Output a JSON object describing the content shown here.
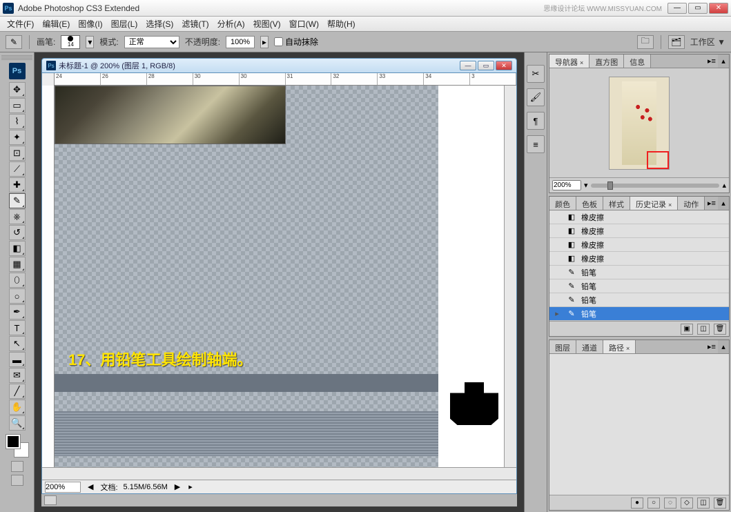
{
  "titlebar": {
    "app_name": "Adobe Photoshop CS3 Extended",
    "ps_abbrev": "Ps",
    "watermark": "思缘设计论坛  WWW.MISSYUAN.COM"
  },
  "menu": {
    "items": [
      "文件(F)",
      "编辑(E)",
      "图像(I)",
      "图层(L)",
      "选择(S)",
      "滤镜(T)",
      "分析(A)",
      "视图(V)",
      "窗口(W)",
      "帮助(H)"
    ]
  },
  "options": {
    "brush_label": "画笔:",
    "brush_size": "14",
    "mode_label": "模式:",
    "mode_value": "正常",
    "opacity_label": "不透明度:",
    "opacity_value": "100%",
    "auto_erase": "自动抹除",
    "workspace": "工作区 ▼"
  },
  "document": {
    "title": "未标题-1 @ 200% (图层 1, RGB/8)",
    "ruler_h": [
      "24",
      "26",
      "28",
      "30",
      "30",
      "31",
      "32",
      "33",
      "34",
      "3"
    ],
    "zoom": "200%",
    "filesize_label": "文档:",
    "filesize": "5.15M/6.56M",
    "annotation": "17、用铅笔工具绘制轴端。"
  },
  "navigator": {
    "tabs": [
      "导航器",
      "直方图",
      "信息"
    ],
    "zoom": "200%"
  },
  "history_panel": {
    "tabs": [
      "颜色",
      "色板",
      "样式",
      "历史记录",
      "动作"
    ],
    "items": [
      {
        "icon": "eraser",
        "label": "橡皮擦",
        "selected": false
      },
      {
        "icon": "eraser",
        "label": "橡皮擦",
        "selected": false
      },
      {
        "icon": "eraser",
        "label": "橡皮擦",
        "selected": false
      },
      {
        "icon": "eraser",
        "label": "橡皮擦",
        "selected": false
      },
      {
        "icon": "pencil",
        "label": "铅笔",
        "selected": false
      },
      {
        "icon": "pencil",
        "label": "铅笔",
        "selected": false
      },
      {
        "icon": "pencil",
        "label": "铅笔",
        "selected": false
      },
      {
        "icon": "pencil",
        "label": "铅笔",
        "selected": true
      }
    ]
  },
  "paths_panel": {
    "tabs": [
      "图层",
      "通道",
      "路径"
    ]
  }
}
